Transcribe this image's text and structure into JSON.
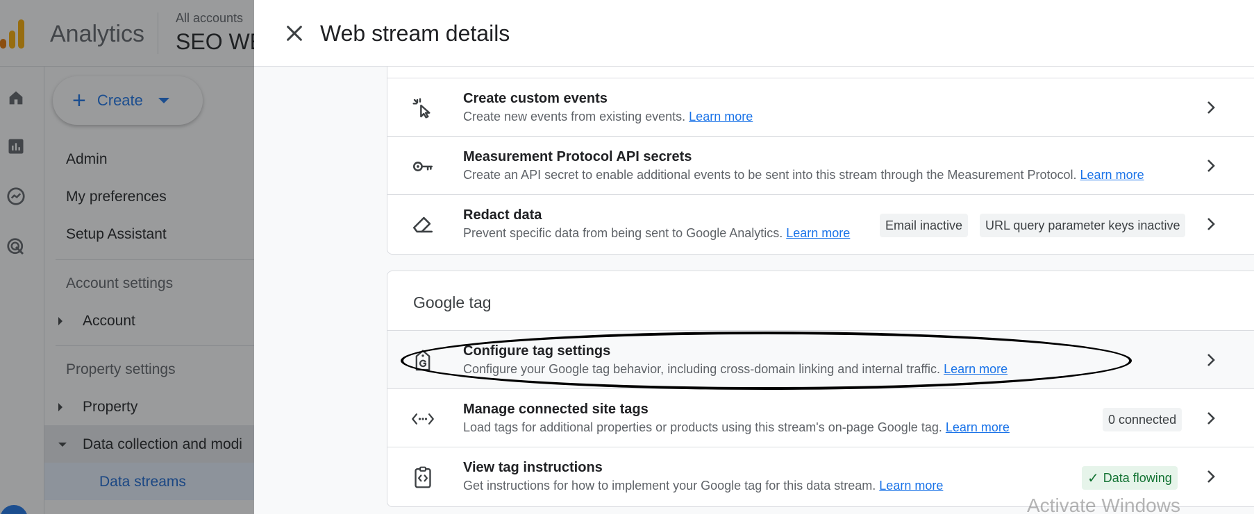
{
  "app": {
    "name": "Analytics",
    "breadcrumb": "All accounts",
    "property_title": "SEO WE"
  },
  "create": {
    "label": "Create"
  },
  "sidebar": {
    "admin": "Admin",
    "my_preferences": "My preferences",
    "setup_assistant": "Setup Assistant",
    "account_settings": "Account settings",
    "account": "Account",
    "property_settings": "Property settings",
    "property": "Property",
    "data_collection": "Data collection and modi",
    "data_streams": "Data streams"
  },
  "panel": {
    "title": "Web stream details",
    "rows": [
      {
        "title": "Create custom events",
        "desc": "Create new events from existing events.",
        "link": "Learn more"
      },
      {
        "title": "Measurement Protocol API secrets",
        "desc": "Create an API secret to enable additional events to be sent into this stream through the Measurement Protocol.",
        "link": "Learn more"
      },
      {
        "title": "Redact data",
        "desc": "Prevent specific data from being sent to Google Analytics.",
        "link": "Learn more",
        "chips": [
          "Email inactive",
          "URL query parameter keys inactive"
        ]
      }
    ],
    "google_tag": {
      "title": "Google tag",
      "rows": [
        {
          "title": "Configure tag settings",
          "desc": "Configure your Google tag behavior, including cross-domain linking and internal traffic.",
          "link": "Learn more"
        },
        {
          "title": "Manage connected site tags",
          "desc": "Load tags for additional properties or products using this stream's on-page Google tag.",
          "link": "Learn more",
          "chip": "0 connected"
        },
        {
          "title": "View tag instructions",
          "desc": "Get instructions for how to implement your Google tag for this data stream.",
          "link": "Learn more",
          "chip": "Data flowing"
        }
      ]
    }
  },
  "watermark": "Activate Windows",
  "icons": {
    "close": "close-icon",
    "custom_events": "cursor-sparkle-icon",
    "api_secrets": "key-icon",
    "redact": "eraser-icon",
    "configure_tag": "google-tag-icon",
    "connected_tags": "code-arrows-icon",
    "tag_instructions": "code-clipboard-icon",
    "chevron": "chevron-right-icon",
    "check": "check-icon"
  },
  "colors": {
    "accent": "#1a73e8",
    "logo": "#f9ab00",
    "success": "#137333"
  }
}
